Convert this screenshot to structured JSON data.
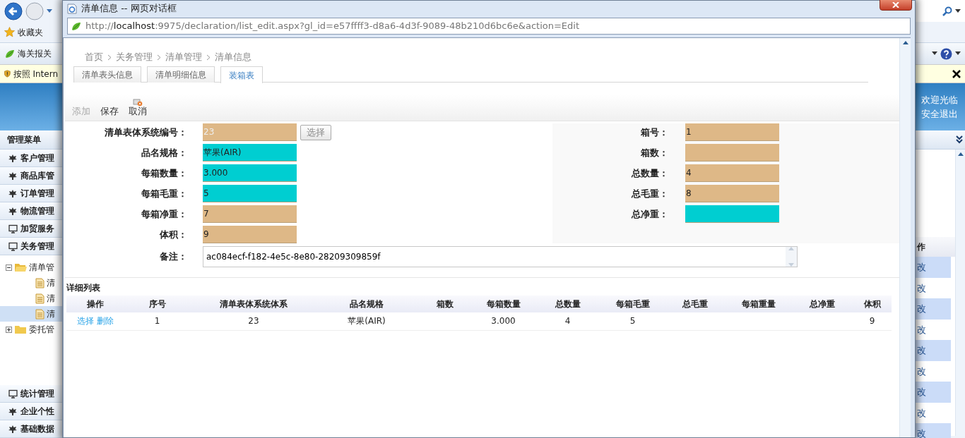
{
  "browser": {
    "favorites": "收藏夹",
    "tab": "海关报关",
    "infobar": "按照 Intern",
    "welcome": "欢迎光临",
    "logout": "安全退出",
    "menu_title": "管理菜单",
    "menu": [
      {
        "label": "客户管理",
        "kind": "leaf"
      },
      {
        "label": "商品库管",
        "kind": "leaf"
      },
      {
        "label": "订单管理",
        "kind": "leaf"
      },
      {
        "label": "物流管理",
        "kind": "leaf"
      },
      {
        "label": "加贸服务",
        "kind": "screen"
      },
      {
        "label": "关务管理",
        "kind": "screen"
      }
    ],
    "tree": [
      {
        "label": "清单管",
        "expanded": true,
        "children": [
          {
            "label": "清",
            "selected": false
          },
          {
            "label": "清",
            "selected": false
          },
          {
            "label": "清",
            "selected": true
          }
        ]
      },
      {
        "label": "委托管",
        "expanded": false
      }
    ],
    "menu_bottom": [
      {
        "label": "统计管理",
        "kind": "screen"
      },
      {
        "label": "企业个性",
        "kind": "leaf"
      },
      {
        "label": "基础数据",
        "kind": "leaf"
      }
    ],
    "grid": {
      "header": "作",
      "rows": [
        "改",
        "改",
        "改",
        "改",
        "改",
        "改",
        "改",
        "改",
        "改"
      ]
    }
  },
  "dialog": {
    "title": "清单信息 -- 网页对话框",
    "url_start": "http://",
    "url_host": "localhost",
    "url_rest": ":9975/declaration/list_edit.aspx?gl_id=e57ffff3-d8a6-4d3f-9089-48b210d6bc6e&action=Edit",
    "breadcrumb": [
      "首页",
      "关务管理",
      "清单管理",
      "清单信息"
    ],
    "tabs": [
      {
        "label": "清单表头信息",
        "selected": false
      },
      {
        "label": "清单明细信息",
        "selected": false
      },
      {
        "label": "装箱表",
        "selected": true
      }
    ],
    "toolbar": [
      {
        "label": "添加",
        "disabled": true,
        "kind": "text"
      },
      {
        "label": "保存",
        "disabled": false,
        "kind": "text"
      },
      {
        "label": "取消",
        "disabled": false,
        "kind": "icon"
      }
    ],
    "form": {
      "left": [
        {
          "label": "清单表体系统编号：",
          "value": "23",
          "color": "#deb887",
          "disabled": true,
          "button": "选择"
        },
        {
          "label": "品名规格：",
          "value": "苹果(AIR)",
          "color": "#00ced1",
          "disabled": false
        },
        {
          "label": "每箱数量：",
          "value": "3.000",
          "color": "#00ced1",
          "disabled": false
        },
        {
          "label": "每箱毛重：",
          "value": "5",
          "color": "#00ced1",
          "disabled": false
        },
        {
          "label": "每箱净重：",
          "value": "7",
          "color": "#deb887",
          "disabled": false
        },
        {
          "label": "体积：",
          "value": "9",
          "color": "#deb887",
          "disabled": false
        }
      ],
      "right": [
        {
          "label": "箱号：",
          "value": "1",
          "color": "#deb887"
        },
        {
          "label": "箱数：",
          "color": "#deb887"
        },
        {
          "label": "总数量：",
          "value": "4",
          "color": "#deb887"
        },
        {
          "label": "总毛重：",
          "value": "8",
          "color": "#deb887"
        },
        {
          "label": "总净重：",
          "color": "#00ced1"
        }
      ],
      "remark": {
        "label": "备注：",
        "value": "ac084ecf-f182-4e5c-8e80-28209309859f"
      }
    },
    "list": {
      "title": "详细列表",
      "columns": [
        "操作",
        "序号",
        "清单表体系统体系",
        "品名规格",
        "箱数",
        "每箱数量",
        "总数量",
        "每箱毛重",
        "总毛重",
        "每箱重量",
        "总净重",
        "体积"
      ],
      "rows": [
        {
          "cells": [
            [
              "选择",
              "删除"
            ],
            "1",
            "23",
            "苹果(AIR)",
            "",
            "3.000",
            "4",
            "5",
            "",
            "",
            "",
            "9"
          ]
        }
      ]
    }
  }
}
